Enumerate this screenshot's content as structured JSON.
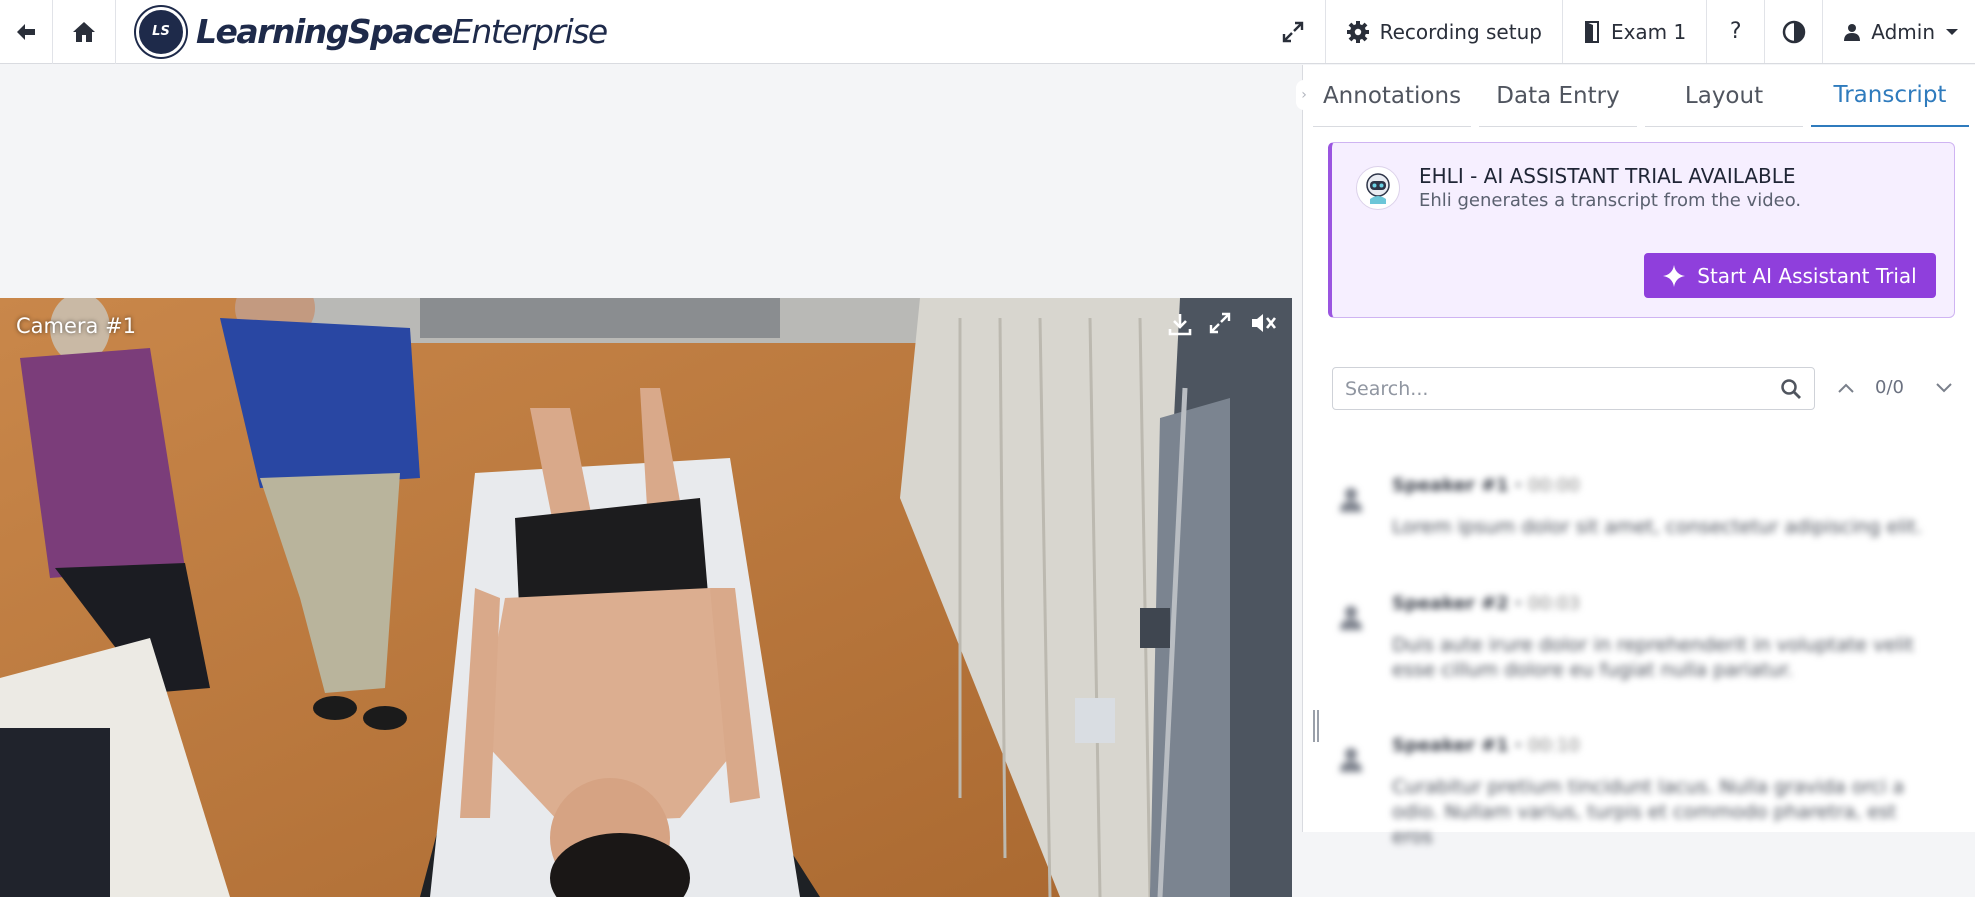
{
  "app": {
    "logo_badge": "LS",
    "logo_bold": "LearningSpace",
    "logo_light": "Enterprise"
  },
  "toolbar": {
    "recording_setup": "Recording setup",
    "exam": "Exam 1",
    "help": "?",
    "user": "Admin"
  },
  "video": {
    "camera_label": "Camera #1"
  },
  "panel": {
    "tabs": [
      {
        "label": "Annotations",
        "active": false
      },
      {
        "label": "Data Entry",
        "active": false
      },
      {
        "label": "Layout",
        "active": false
      },
      {
        "label": "Transcript",
        "active": true
      }
    ],
    "ai_card": {
      "title": "EHLI - AI ASSISTANT TRIAL AVAILABLE",
      "subtitle": "Ehli generates a transcript from the video.",
      "button": "Start AI Assistant Trial"
    },
    "search": {
      "placeholder": "Search...",
      "value": "",
      "counter": "0/0"
    },
    "transcript": [
      {
        "speaker": "Speaker #1",
        "time": "00:00",
        "text": "Lorem ipsum dolor sit amet, consectetur adipiscing elit."
      },
      {
        "speaker": "Speaker #2",
        "time": "00:03",
        "text": "Duis aute irure dolor in reprehenderit in voluptate velit esse cillum dolore eu fugiat nulla pariatur."
      },
      {
        "speaker": "Speaker #1",
        "time": "00:10",
        "text": "Curabitur pretium tincidunt lacus. Nulla gravida orci a odio. Nullam varius, turpis et commodo pharetra, est eros"
      }
    ]
  },
  "colors": {
    "accent": "#2f7bbd",
    "ai_purple": "#8f3fdc",
    "ai_bg": "#f6efff",
    "navy": "#1e2a4a"
  }
}
